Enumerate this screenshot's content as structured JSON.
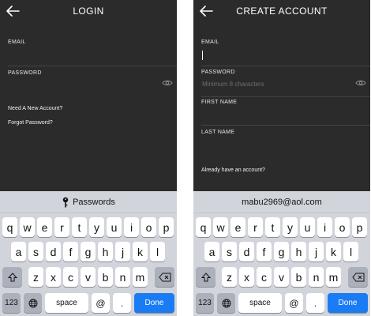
{
  "login": {
    "title": "LOGIN",
    "email_label": "EMAIL",
    "password_label": "PASSWORD",
    "need_account": "Need A New Account?",
    "forgot_password": "Forgot Password?",
    "suggestion": "Passwords"
  },
  "create": {
    "title": "CREATE ACCOUNT",
    "email_label": "EMAIL",
    "password_label": "PASSWORD",
    "password_placeholder": "Minimum 8 characters",
    "first_name_label": "FIRST NAME",
    "last_name_label": "LAST NAME",
    "have_account": "Already have an account?",
    "suggestion": "mabu2969@aol.com"
  },
  "keyboard": {
    "row1": [
      "q",
      "w",
      "e",
      "r",
      "t",
      "y",
      "u",
      "i",
      "o",
      "p"
    ],
    "row2": [
      "a",
      "s",
      "d",
      "f",
      "g",
      "h",
      "j",
      "k",
      "l"
    ],
    "row3": [
      "z",
      "x",
      "c",
      "v",
      "b",
      "n",
      "m"
    ],
    "numbers_key": "123",
    "space_key": "space",
    "at_key": "@",
    "dot_key": ".",
    "done_key": "Done"
  },
  "icons": {
    "back": "arrow-left-icon",
    "eye": "eye-icon",
    "key": "key-icon",
    "shift": "shift-icon",
    "delete": "delete-icon",
    "globe": "globe-icon"
  }
}
